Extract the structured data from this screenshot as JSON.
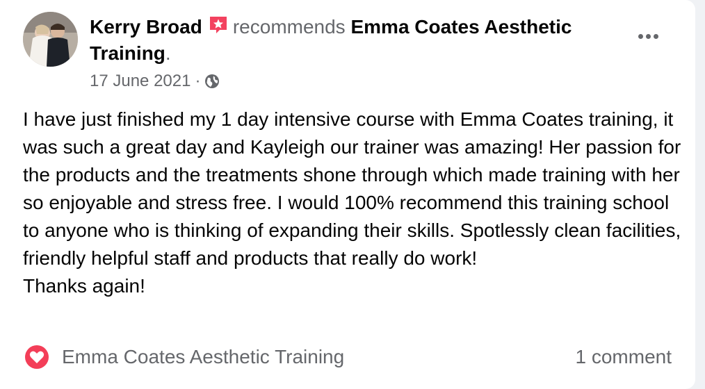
{
  "post": {
    "author": "Kerry Broad",
    "verb": "recommends",
    "page_name": "Emma Coates Aesthetic Training",
    "period": ".",
    "date": "17 June 2021",
    "separator": "·",
    "audience_icon": "globe-icon",
    "author_badge_icon": "recommendation-star-icon",
    "more_icon": "more-options-icon",
    "body": "I have just finished my 1 day intensive course with Emma Coates training, it was such a great day and Kayleigh our trainer was amazing! Her passion for the products and the treatments shone through which made training with her so enjoyable and stress free. I would 100% recommend this training school to anyone who is thinking of expanding their skills. Spotlessly clean facilities, friendly helpful staff and products that really do work!\nThanks again!"
  },
  "footer": {
    "reaction_icon": "love-reaction-icon",
    "reactor": "Emma Coates Aesthetic Training",
    "comments": "1 comment"
  },
  "colors": {
    "text_primary": "#050505",
    "text_secondary": "#65676b",
    "recommend_badge": "#f3425f",
    "love_reaction": "#f33e58",
    "card_background": "#ffffff"
  }
}
